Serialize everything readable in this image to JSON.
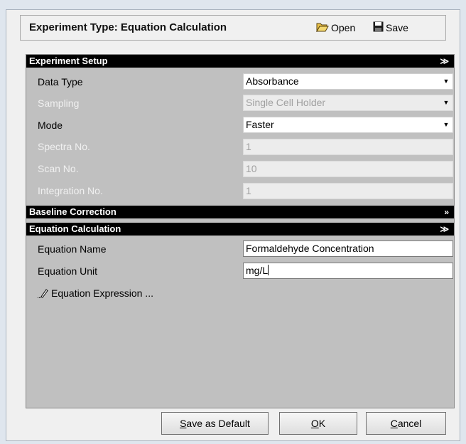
{
  "header": {
    "title": "Experiment Type:  Equation Calculation",
    "open_label": "Open",
    "save_label": "Save"
  },
  "sections": {
    "setup": {
      "title": "Experiment Setup",
      "rows": {
        "data_type": {
          "label": "Data Type",
          "value": "Absorbance"
        },
        "sampling": {
          "label": "Sampling",
          "value": "Single Cell Holder"
        },
        "mode": {
          "label": "Mode",
          "value": "Faster"
        },
        "spectra_no": {
          "label": "Spectra No.",
          "value": "1"
        },
        "scan_no": {
          "label": "Scan No.",
          "value": "10"
        },
        "integration_no": {
          "label": "Integration No.",
          "value": "1"
        }
      }
    },
    "baseline": {
      "title": "Baseline Correction"
    },
    "equation": {
      "title": "Equation Calculation",
      "name": {
        "label": "Equation Name",
        "value": "Formaldehyde Concentration"
      },
      "unit": {
        "label": "Equation Unit",
        "value": "mg/L"
      },
      "expression_link": "Equation Expression ..."
    }
  },
  "footer": {
    "save_default_first": "S",
    "save_default_rest": "ave as Default",
    "ok_first": "O",
    "ok_rest": "K",
    "cancel_first": "C",
    "cancel_rest": "ancel"
  }
}
